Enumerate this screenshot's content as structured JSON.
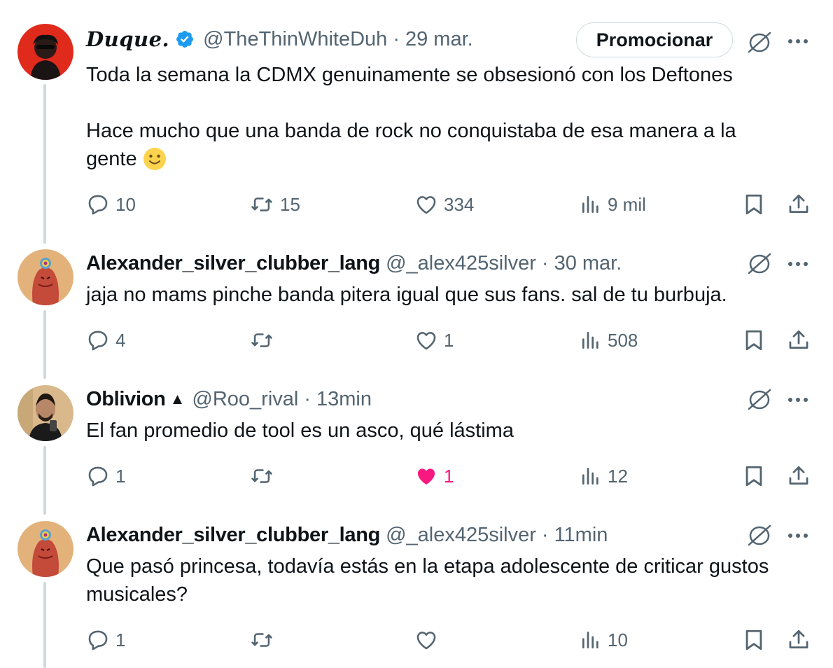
{
  "promote_label": "Promocionar",
  "tweets": [
    {
      "name": "Duque.",
      "verified": true,
      "handle": "@TheThinWhiteDuh",
      "time": "29 mar.",
      "text_lines": [
        "Toda la semana la CDMX genuinamente se obsesionó con los Deftones",
        "",
        "Hace mucho que una banda de rock no conquistaba de esa manera a la",
        "gente 🙂"
      ],
      "replies": "10",
      "retweets": "15",
      "likes": "334",
      "views": "9 mil",
      "liked": false
    },
    {
      "name": "Alexander_silver_clubber_lang",
      "handle": "@_alex425silver",
      "time": "30 mar.",
      "text_lines": [
        "jaja no mams pinche banda pitera igual que sus fans. sal de tu burbuja."
      ],
      "replies": "4",
      "retweets": "",
      "likes": "1",
      "views": "508",
      "liked": false
    },
    {
      "name": "Oblivion",
      "name_badge": "▲",
      "handle": "@Roo_rival",
      "time": "13min",
      "text_lines": [
        "El fan promedio de tool es un asco, qué lástima"
      ],
      "replies": "1",
      "retweets": "",
      "likes": "1",
      "views": "12",
      "liked": true
    },
    {
      "name": "Alexander_silver_clubber_lang",
      "handle": "@_alex425silver",
      "time": "11min",
      "text_lines": [
        "Que pasó princesa, todavía estás en la etapa adolescente de criticar gustos",
        "musicales?"
      ],
      "replies": "1",
      "retweets": "",
      "likes": "",
      "views": "10",
      "liked": false
    }
  ],
  "colors": {
    "text_primary": "#0f1419",
    "text_secondary": "#536471",
    "verified_blue": "#1d9bf0",
    "like_pink": "#f91880",
    "thread_line": "#cfd9de"
  },
  "icons": [
    "reply-icon",
    "retweet-icon",
    "like-icon",
    "views-icon",
    "bookmark-icon",
    "share-icon",
    "grok-icon",
    "more-icon",
    "verified-badge-icon"
  ]
}
